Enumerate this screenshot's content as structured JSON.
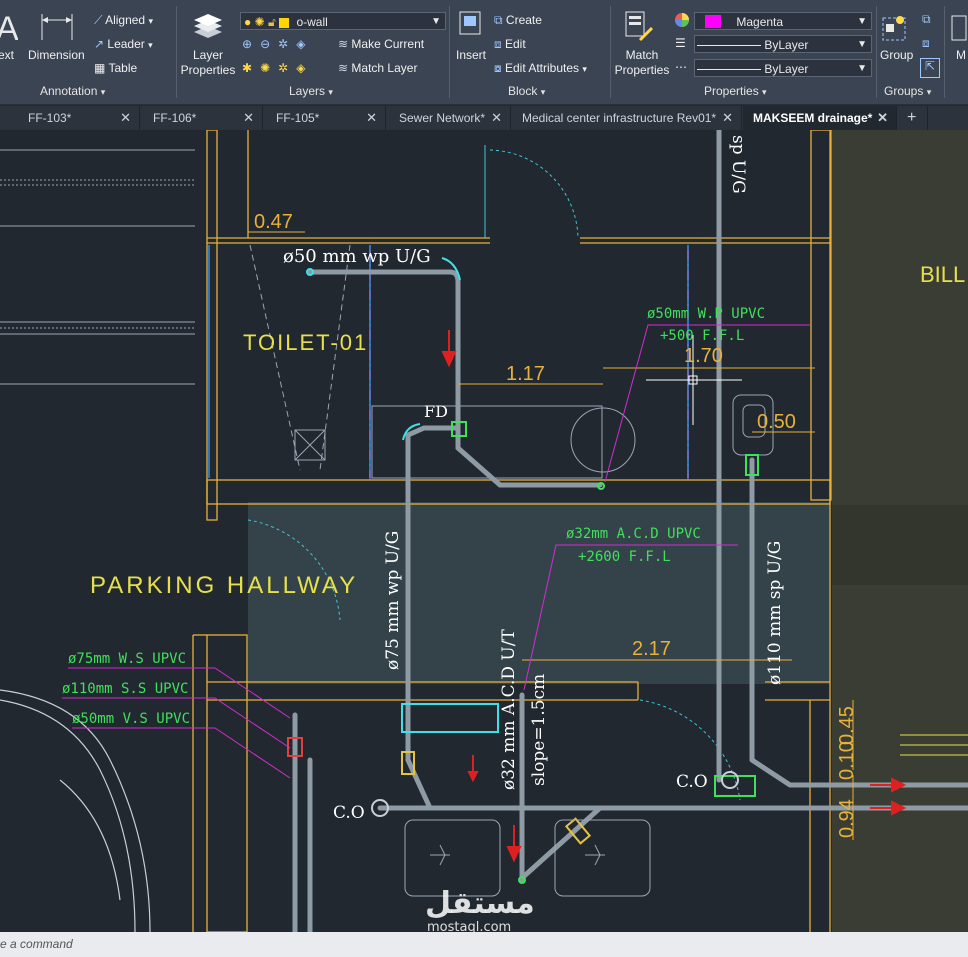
{
  "ribbon": {
    "annotation": {
      "text_partial": "ext",
      "dimension": "Dimension",
      "aligned": "Aligned",
      "leader": "Leader",
      "table": "Table",
      "panel": "Annotation"
    },
    "layers": {
      "layer_properties_line1": "Layer",
      "layer_properties_line2": "Properties",
      "current_layer": "o-wall",
      "make_current": "Make Current",
      "match_layer": "Match Layer",
      "panel": "Layers"
    },
    "block": {
      "insert": "Insert",
      "create": "Create",
      "edit": "Edit",
      "edit_attributes": "Edit Attributes",
      "panel": "Block"
    },
    "properties": {
      "match_line1": "Match",
      "match_line2": "Properties",
      "color": "Magenta",
      "linetype": "ByLayer",
      "lineweight": "ByLayer",
      "panel": "Properties",
      "color_swatch": "#ff00ff"
    },
    "groups": {
      "group": "Group",
      "panel": "Groups"
    }
  },
  "tabs": [
    {
      "label": "FF-103*"
    },
    {
      "label": "FF-106*"
    },
    {
      "label": "FF-105*"
    },
    {
      "label": "Sewer Network*"
    },
    {
      "label": "Medical center infrastructure Rev01*"
    },
    {
      "label": "MAKSEEM drainage*",
      "active": true
    }
  ],
  "drawing": {
    "dim_047": "0.47",
    "dim_117": "1.17",
    "dim_170": "1.70",
    "dim_050": "0.50",
    "dim_217": "2.17",
    "dim_045": "0.45",
    "dim_094": "0.94",
    "dim_010": "0.10",
    "pipe_50_wp": "ø50 mm wp U/G",
    "toilet": "TOILET-01",
    "fd": "FD",
    "note_50mm_wp": "ø50mm W.P UPVC",
    "note_500_ffl": "+500 F.F.L",
    "note_32mm_acd": "ø32mm A.C.D UPVC",
    "note_2600_ffl": "+2600 F.F.L",
    "parking": "PARKING HALLWAY",
    "pipe_75_wp": "ø75 mm wp U/G",
    "pipe_110_sp": "ø110 mm sp U/G",
    "pipe_32_acd": "ø32 mm A.C.D U/T",
    "slope": "slope=1.5cm",
    "note_75_ws": "ø75mm W.S UPVC",
    "note_110_ss": "ø110mm S.S UPVC",
    "note_50_vs": "ø50mm V.S UPVC",
    "co": "C.O",
    "bill": "BILL",
    "sp_ug_top": "sp U/G"
  },
  "command_line": {
    "placeholder": "e a command"
  },
  "watermark": {
    "arabic": "مستقل",
    "latin": "mostaql.com"
  }
}
